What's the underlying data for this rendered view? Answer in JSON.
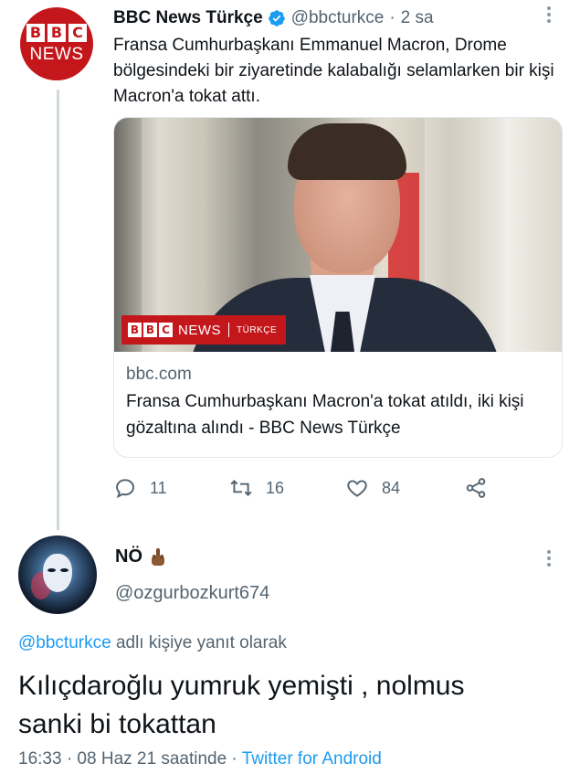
{
  "tweet": {
    "author_name": "BBC News Türkçe",
    "handle": "@bbcturkce",
    "separator": "·",
    "time": "2 sa",
    "avatar": {
      "letters": [
        "B",
        "B",
        "C"
      ],
      "word": "NEWS"
    },
    "text": "Fransa Cumhurbaşkanı Emmanuel Macron, Drome bölgesindeki bir ziyaretinde kalabalığı selamlarken bir kişi Macron'a  tokat attı.",
    "card": {
      "image_banner": {
        "letters": [
          "B",
          "B",
          "C"
        ],
        "word": "NEWS",
        "sub": "TÜRKÇE"
      },
      "domain": "bbc.com",
      "title": "Fransa Cumhurbaşkanı Macron'a tokat atıldı, iki kişi gözaltına alındı - BBC News Türkçe"
    },
    "actions": {
      "reply_count": "11",
      "retweet_count": "16",
      "like_count": "84",
      "share_icon": "share-icon"
    }
  },
  "reply": {
    "name": "NÖ",
    "emoji_icon": "middle-finger-icon",
    "handle": "@ozgurbozkurt674",
    "reply_to_link": "@bbcturkce",
    "reply_to_text": " adlı kişiye yanıt olarak",
    "text_line1": "Kılıçdaroğlu yumruk yemişti , nolmus",
    "text_line2": "sanki bi tokattan",
    "meta_time": "16:33 · 08 Haz 21 saatinde · ",
    "meta_source": "Twitter for Android"
  },
  "colors": {
    "bbc_red": "#c4171b",
    "link_blue": "#1d9bf0",
    "secondary_text": "#536471",
    "thread_line": "#cfd9de"
  }
}
